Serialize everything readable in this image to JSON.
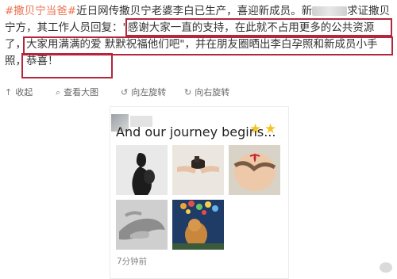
{
  "post": {
    "line1_hashtag": "#撒贝宁当爸#",
    "line1_text": "近日网传撒贝宁老婆李白已生产，喜迎新成员。新",
    "line1_text_end": "求证撒贝",
    "line2_text_start": "宁方，其工作人员回复：",
    "line2_quote": "\"感谢大家一直的支持，在此就不占用更多的公共资源",
    "line3_text_start": "了，",
    "line3_quote": "大家用满满的爱 默默祝福他们吧\"",
    "line3_text_end": "，并在朋友圈晒出李白孕照和新成员小手",
    "line4_text_start": "照，",
    "line4_quote": "恭喜！"
  },
  "toolbar": {
    "collapse": "收起",
    "view_large": "查看大图",
    "rotate_left": "向左旋转",
    "rotate_right": "向右旋转"
  },
  "card": {
    "title": "And our journey begins...",
    "timestamp": "7分钟前"
  },
  "icons": {
    "collapse": "collapse-icon",
    "view_large": "magnify-icon",
    "rotate_left": "rotate-left-icon",
    "rotate_right": "rotate-right-icon",
    "star": "star-icon"
  },
  "colors": {
    "hashtag": "#eb7350",
    "highlight_box": "#b3263c",
    "star": "#f4c224"
  }
}
